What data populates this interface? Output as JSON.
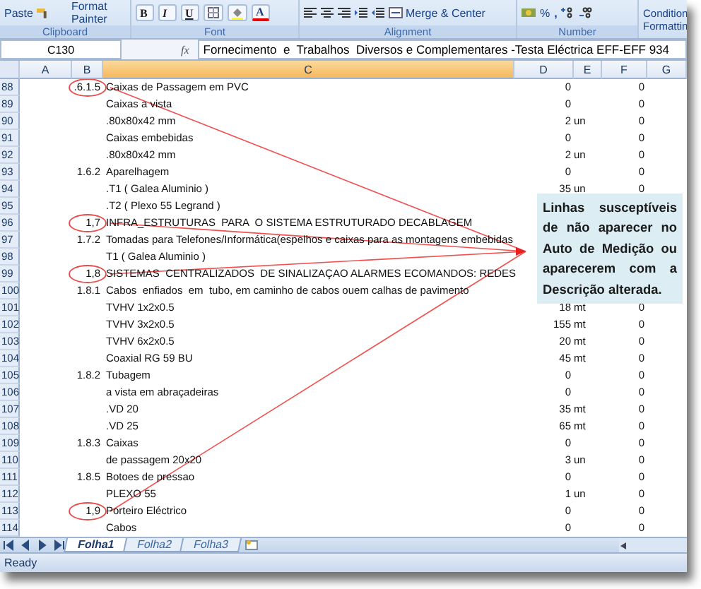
{
  "ribbon": {
    "paste": "Paste",
    "format_painter": "Format Painter",
    "font_buttons": [
      "B",
      "I",
      "U"
    ],
    "font_color": "A",
    "merge": "Merge & Center",
    "percent": "%",
    "comma": ",",
    "conditional": [
      "Condition",
      "Formattin"
    ],
    "groups": [
      "Clipboard",
      "Font",
      "Alignment",
      "Number"
    ]
  },
  "formula_bar": {
    "cell": "C130",
    "fx": "fx",
    "value": "Fornecimento  e  Trabalhos  Diversos e Complementares -Testa Eléctrica EFF-EFF 934"
  },
  "columns": [
    {
      "label": "A",
      "selected": false
    },
    {
      "label": "B",
      "selected": false
    },
    {
      "label": "C",
      "selected": true
    },
    {
      "label": "D",
      "selected": false
    },
    {
      "label": "E",
      "selected": false
    },
    {
      "label": "F",
      "selected": false
    },
    {
      "label": "G",
      "selected": false
    }
  ],
  "rows": [
    {
      "n": "88",
      "code": ".6.1.5",
      "text": "Caixas de Passagem em PVC",
      "qty": "0",
      "f": "0",
      "circled": true
    },
    {
      "n": "89",
      "text": "Caixas a vista",
      "qty": "0",
      "f": "0",
      "circled": false
    },
    {
      "n": "90",
      "text": ".80x80x42 mm",
      "qty": "2",
      "unit": "un",
      "f": "0",
      "circled": false
    },
    {
      "n": "91",
      "text": "Caixas embebidas",
      "qty": "0",
      "f": "0",
      "circled": false
    },
    {
      "n": "92",
      "text": ".80x80x42 mm",
      "qty": "2",
      "unit": "un",
      "f": "0",
      "circled": false
    },
    {
      "n": "93",
      "code": "1.6.2",
      "text": "Aparelhagem",
      "qty": "0",
      "f": "0",
      "circled": false
    },
    {
      "n": "94",
      "text": ".T1 ( Galea Aluminio )",
      "qty": "35",
      "unit": "un",
      "f": "0",
      "circled": false
    },
    {
      "n": "95",
      "text": ".T2 ( Plexo 55 Legrand )",
      "circled": false
    },
    {
      "n": "96",
      "code": "1,7",
      "text": "INFRA_ESTRUTURAS  PARA  O SISTEMA ESTRUTURADO DECABLAGEM",
      "circled": true
    },
    {
      "n": "97",
      "code": "1.7.2",
      "text": "Tomadas para Telefones/Informática(espelhos e caixas para as montagens embebidas",
      "circled": false
    },
    {
      "n": "98",
      "text": "T1 ( Galea Aluminio )",
      "circled": false
    },
    {
      "n": "99",
      "code": "1,8",
      "text": "SISTEMAS  CENTRALIZADOS  DE SINALIZAÇAO ALARMES ECOMANDOS: REDES",
      "circled": true
    },
    {
      "n": "100",
      "code": "1.8.1",
      "text": "Cabos  enfiados  em  tubo, em caminho de cabos ouem calhas de pavimento",
      "circled": false
    },
    {
      "n": "101",
      "text": "TVHV 1x2x0.5",
      "qty": "18",
      "unit": "mt",
      "f": "0",
      "circled": false
    },
    {
      "n": "102",
      "text": "TVHV 3x2x0.5",
      "qty": "155",
      "unit": "mt",
      "f": "0",
      "circled": false
    },
    {
      "n": "103",
      "text": "TVHV 6x2x0.5",
      "qty": "20",
      "unit": "mt",
      "f": "0",
      "circled": false
    },
    {
      "n": "104",
      "text": "Coaxial RG 59 BU",
      "qty": "45",
      "unit": "mt",
      "f": "0",
      "circled": false
    },
    {
      "n": "105",
      "code": "1.8.2",
      "text": "Tubagem",
      "qty": "0",
      "f": "0",
      "circled": false
    },
    {
      "n": "106",
      "text": "a vista em abraçadeiras",
      "qty": "0",
      "f": "0",
      "circled": false
    },
    {
      "n": "107",
      "text": ".VD 20",
      "qty": "35",
      "unit": "mt",
      "f": "0",
      "circled": false
    },
    {
      "n": "108",
      "text": ".VD 25",
      "qty": "65",
      "unit": "mt",
      "f": "0",
      "circled": false
    },
    {
      "n": "109",
      "code": "1.8.3",
      "text": "Caixas",
      "qty": "0",
      "f": "0",
      "circled": false
    },
    {
      "n": "110",
      "text": "de passagem 20x20",
      "qty": "3",
      "unit": "un",
      "f": "0",
      "circled": false
    },
    {
      "n": "111",
      "code": "1.8.5",
      "text": "Botoes de pressao",
      "qty": "0",
      "f": "0",
      "circled": false
    },
    {
      "n": "112",
      "text": "PLEXO 55",
      "qty": "1",
      "unit": "un",
      "f": "0",
      "circled": false
    },
    {
      "n": "113",
      "code": "1,9",
      "text": "Porteiro Eléctrico",
      "qty": "0",
      "f": "0",
      "circled": true
    },
    {
      "n": "114",
      "text": "Cabos",
      "qty": "0",
      "f": "0",
      "circled": false
    }
  ],
  "callout": "Linhas susceptíveis de não aparecer no Auto de Medição ou aparecerem com a Descrição alterada.",
  "sheets": [
    {
      "label": "Folha1",
      "selected": true
    },
    {
      "label": "Folha2",
      "selected": false
    },
    {
      "label": "Folha3",
      "selected": false
    }
  ],
  "status_bar": "Ready"
}
